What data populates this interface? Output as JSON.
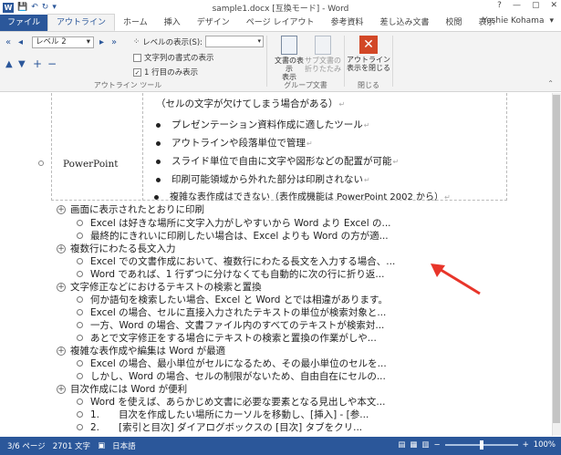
{
  "window": {
    "title": "sample1.docx [互換モード] - Word",
    "help": "?",
    "min": "—",
    "max": "▢",
    "close": "✕"
  },
  "tabs": [
    "ファイル",
    "アウトライン",
    "ホーム",
    "挿入",
    "デザイン",
    "ページ レイアウト",
    "参考資料",
    "差し込み文書",
    "校閲",
    "表示"
  ],
  "user": "Yoshie Kohama",
  "ribbon": {
    "level": "レベル 2",
    "show_level_label": "レベルの表示(S):",
    "text_format_label": "文字列の書式の表示",
    "first_line_label": "1 行目のみ表示",
    "outline_tools_label": "アウトライン ツール",
    "show_doc_label": "文書の表示",
    "show_doc_label2": "表示",
    "sub_doc_label": "サブ文書の",
    "sub_doc_label2": "折りたたみ",
    "group_doc_label": "グループ文書",
    "close_outline_label": "アウトライン",
    "close_outline_label2": "表示を閉じる",
    "close_group_label": "閉じる"
  },
  "doc": {
    "table_cell": "PowerPoint",
    "table_top": "（セルの文字が欠けてしまう場合がある）",
    "table_lines": [
      "プレゼンテーション資料作成に適したツール",
      "アウトラインや段落単位で管理",
      "スライド単位で自由に文字や図形などの配置が可能",
      "印刷可能領域から外れた部分は印刷されない",
      "複雑な表作成はできない（表作成機能は PowerPoint 2002 から）"
    ],
    "outline": [
      {
        "level": 1,
        "text": "画面に表示されたとおりに印刷"
      },
      {
        "level": 2,
        "text": "Excel は好きな場所に文字入力がしやすいから Word より Excel の..."
      },
      {
        "level": 2,
        "text": "最終的にきれいに印刷したい場合は、Excel よりも Word の方が適..."
      },
      {
        "level": 1,
        "text": "複数行にわたる長文入力"
      },
      {
        "level": 2,
        "text": "Excel での文書作成において、複数行にわたる長文を入力する場合、..."
      },
      {
        "level": 2,
        "text": "Word であれば、1 行ずつに分けなくても自動的に次の行に折り返..."
      },
      {
        "level": 1,
        "text": "文字修正などにおけるテキストの検索と置換"
      },
      {
        "level": 2,
        "text": "何か語句を検索したい場合、Excel と Word とでは相違があります。"
      },
      {
        "level": 2,
        "text": "Excel の場合、セルに直接入力されたテキストの単位が検索対象と..."
      },
      {
        "level": 2,
        "text": "一方、Word の場合、文書ファイル内のすべてのテキストが検索対..."
      },
      {
        "level": 2,
        "text": "あとで文字修正をする場合にテキストの検索と置換の作業がしや..."
      },
      {
        "level": 1,
        "text": "複雑な表作成や編集は Word が最適"
      },
      {
        "level": 2,
        "text": "Excel の場合、最小単位がセルになるため、その最小単位のセルを..."
      },
      {
        "level": 2,
        "text": "しかし、Word の場合、セルの制限がないため、自由自在にセルの..."
      },
      {
        "level": 1,
        "text": "目次作成には Word が便利"
      },
      {
        "level": 2,
        "text": "Word を使えば、あらかじめ文書に必要な要素となる見出しや本文..."
      },
      {
        "level": 2,
        "text": "1.　　目次を作成したい場所にカーソルを移動し、[挿入] - [参..."
      },
      {
        "level": 2,
        "text": "2.　　[索引と目次] ダイアログボックスの [目次] タブをクリ..."
      }
    ]
  },
  "status": {
    "page": "3/6 ページ",
    "words": "2701 文字",
    "lang": "日本語",
    "zoom": "100%",
    "zoom_fraction": 0.5
  }
}
